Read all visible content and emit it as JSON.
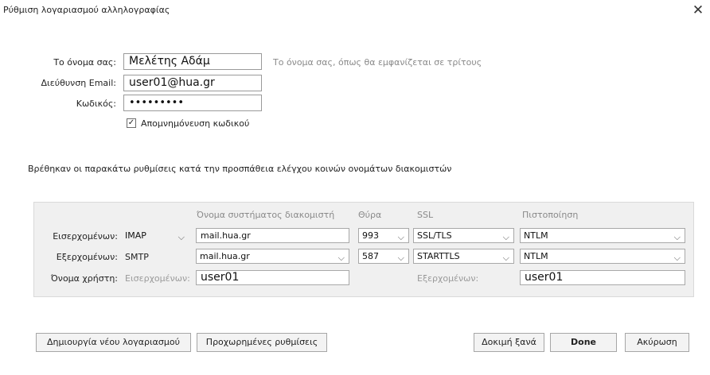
{
  "dialog": {
    "title": "Ρύθμιση λογαριασμού αλληλογραφίας",
    "close_symbol": "✕"
  },
  "form": {
    "name_label": "Το όνομα σας:",
    "name_value": "Μελέτης Αδάμ",
    "name_hint": "Το όνομα σας, όπως θα εμφανίζεται σε τρίτους",
    "email_label": "Διεύθυνση Email:",
    "email_value": "user01@hua.gr",
    "password_label": "Κωδικός:",
    "password_value": "•••••••••",
    "remember_label": "Απομνημόνευση κωδικού",
    "remember_checked": true,
    "remember_mark": "✓"
  },
  "message": "Βρέθηκαν οι παρακάτω ρυθμίσεις κατά την προσπάθεια ελέγχου κοινών ονομάτων διακομιστών",
  "server_table": {
    "headers": {
      "hostname": "Όνομα συστήματος διακομιστή",
      "port": "Θύρα",
      "ssl": "SSL",
      "auth": "Πιστοποίηση"
    },
    "incoming": {
      "label": "Εισερχομένων:",
      "protocol": "IMAP",
      "hostname": "mail.hua.gr",
      "port": "993",
      "ssl": "SSL/TLS",
      "auth": "NTLM"
    },
    "outgoing": {
      "label": "Εξερχομένων:",
      "protocol": "SMTP",
      "hostname": "mail.hua.gr",
      "port": "587",
      "ssl": "STARTTLS",
      "auth": "NTLM"
    },
    "username": {
      "label": "Όνομα χρήστη:",
      "incoming_label": "Εισερχομένων:",
      "incoming_value": "user01",
      "outgoing_label": "Εξερχομένων:",
      "outgoing_value": "user01"
    }
  },
  "buttons": {
    "new_account": "Δημιουργία νέου λογαριασμού",
    "advanced": "Προχωρημένες ρυθμίσεις",
    "retest": "Δοκιμή ξανά",
    "done": "Done",
    "cancel": "Ακύρωση"
  },
  "icons": {
    "chevron": "⌵"
  }
}
